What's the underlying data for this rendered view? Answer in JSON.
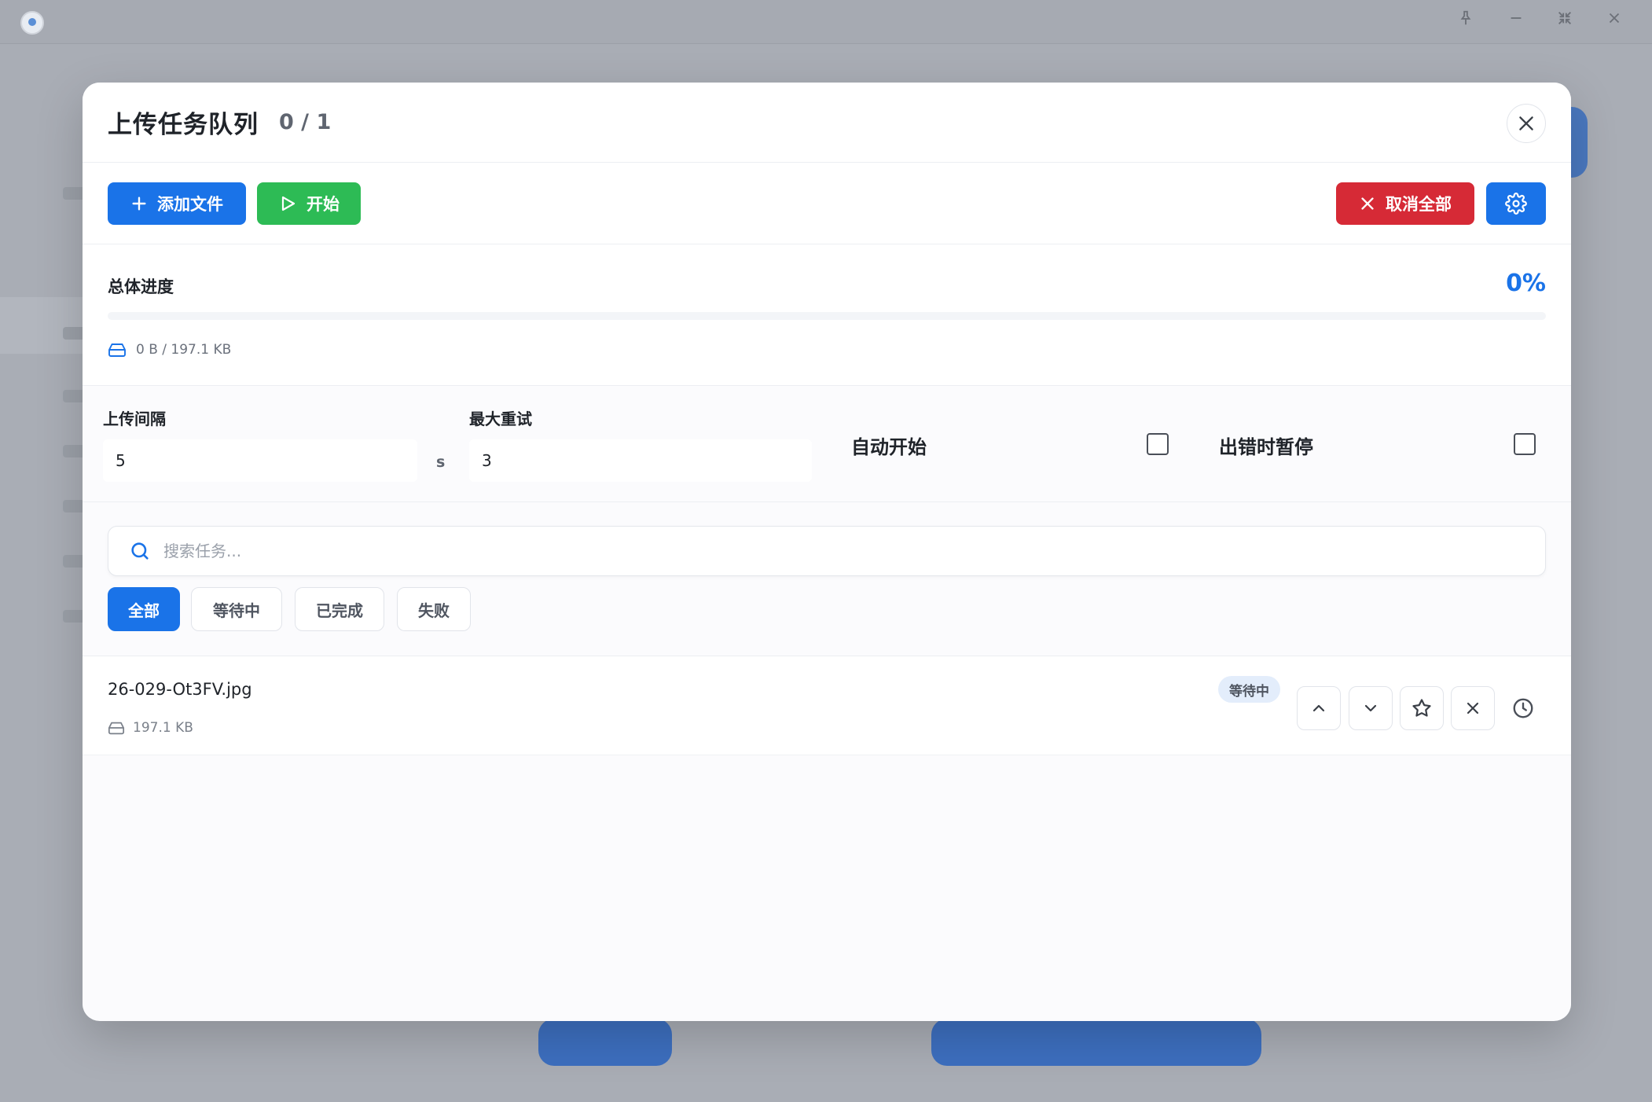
{
  "modal": {
    "title": "上传任务队列",
    "count": "0 / 1"
  },
  "toolbar": {
    "add_label": "添加文件",
    "start_label": "开始",
    "cancel_all_label": "取消全部"
  },
  "progress": {
    "label": "总体进度",
    "percent_text": "0%",
    "percent_value": 0,
    "size_text": "0 B / 197.1 KB"
  },
  "settings": {
    "interval_label": "上传间隔",
    "interval_value": "5",
    "interval_unit": "s",
    "retry_label": "最大重试",
    "retry_value": "3",
    "auto_start_label": "自动开始",
    "auto_start_checked": false,
    "pause_on_error_label": "出错时暂停",
    "pause_on_error_checked": false
  },
  "search": {
    "placeholder": "搜索任务..."
  },
  "filters": {
    "tabs": [
      "全部",
      "等待中",
      "已完成",
      "失败"
    ],
    "active": "全部"
  },
  "tasks": [
    {
      "name": "26-029-Ot3FV.jpg",
      "size": "197.1 KB",
      "status": "等待中"
    }
  ],
  "colors": {
    "primary": "#1a73e8",
    "success": "#2dbb55",
    "danger": "#d62a36",
    "badge_bg": "#e3edfb"
  },
  "icons": {
    "add": "plus-icon",
    "start": "play-icon",
    "cancel_all": "x-icon",
    "settings": "gear-icon",
    "close": "close-icon",
    "drive": "hard-drive-icon",
    "search": "search-icon",
    "move_up": "chevron-up-icon",
    "move_down": "chevron-down-icon",
    "priority": "star-icon",
    "remove": "x-icon",
    "schedule": "clock-icon"
  }
}
